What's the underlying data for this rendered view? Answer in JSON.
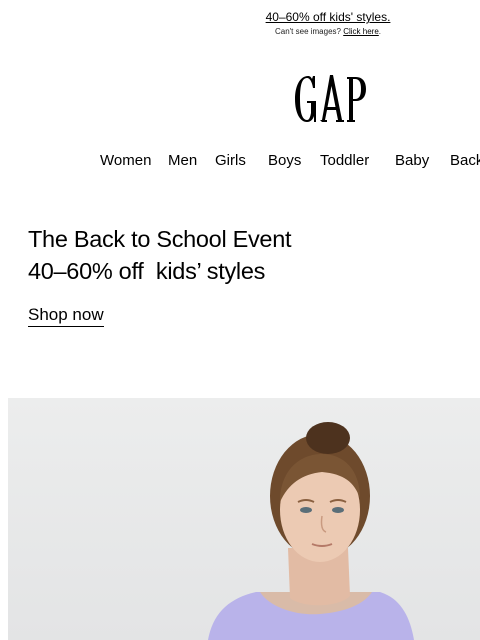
{
  "preheader": {
    "promo_link": "40–60% off kids' styles.",
    "cant_see_text": "Can't see images?",
    "click_here": "Click here",
    "period": "."
  },
  "brand": {
    "logo_text": "GAP"
  },
  "nav": {
    "items": [
      {
        "label": "Women"
      },
      {
        "label": "Men"
      },
      {
        "label": "Girls"
      },
      {
        "label": "Boys"
      },
      {
        "label": "Toddler"
      },
      {
        "label": "Baby"
      },
      {
        "label": "Back"
      }
    ]
  },
  "promo": {
    "headline_line1": "The Back to School Event",
    "headline_line2": "40–60% off  kids’ styles",
    "cta": "Shop now"
  },
  "hero": {
    "description": ""
  }
}
